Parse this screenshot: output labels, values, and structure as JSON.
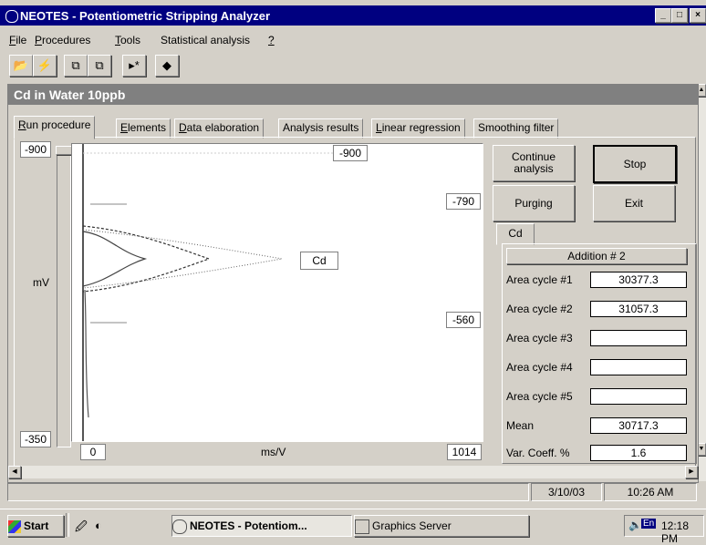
{
  "window": {
    "title": "NEOTES - Potentiometric Stripping Analyzer",
    "controls": [
      "_",
      "ÿ",
      "×"
    ]
  },
  "menu": [
    {
      "mnemonic": "F",
      "rest": "ile"
    },
    {
      "mnemonic": "P",
      "rest": "rocedures"
    },
    {
      "mnemonic": "T",
      "rest": "ools"
    },
    {
      "label": "Statistical analysis"
    },
    {
      "mnemonic": "?",
      "rest": ""
    }
  ],
  "toolbar_icons": [
    "open-folder-icon",
    "electrode-icon",
    "copy-icon",
    "paste-icon",
    "play-step-icon",
    "sample-icon"
  ],
  "document": {
    "title": "Cd in Water 10ppb",
    "tabs": [
      {
        "mnemonic": "R",
        "rest": "un procedure",
        "active": true
      },
      {
        "mnemonic": "E",
        "rest": "lements"
      },
      {
        "mnemonic": "D",
        "rest": "ata elaboration"
      },
      {
        "label": "Analysis results"
      },
      {
        "mnemonic": "L",
        "rest": "inear regression"
      },
      {
        "label": "Smoothing filter"
      }
    ]
  },
  "chart": {
    "y_top": "-900",
    "y_bottom": "-350",
    "y_unit": "mV",
    "x_left": "0",
    "x_right": "1014",
    "x_unit": "ms/V",
    "marker_top": "-900",
    "marker_mid": "-790",
    "marker_low": "-560",
    "peak_label": "Cd"
  },
  "chart_data": {
    "type": "line",
    "title": "",
    "xlabel": "ms/V",
    "ylabel": "mV",
    "xlim": [
      0,
      1014
    ],
    "ylim": [
      -900,
      -350
    ],
    "annotations": [
      "-900",
      "-790",
      "-560",
      "Cd"
    ]
  },
  "buttons": {
    "continue": "Continue analysis",
    "stop": "Stop",
    "purging": "Purging",
    "exit": "Exit"
  },
  "results": {
    "element_tab": "Cd",
    "header": "Addition # 2",
    "rows": [
      {
        "label": "Area cycle #1",
        "value": "30377.3"
      },
      {
        "label": "Area cycle #2",
        "value": "31057.3"
      },
      {
        "label": "Area cycle #3",
        "value": ""
      },
      {
        "label": "Area cycle #4",
        "value": ""
      },
      {
        "label": "Area cycle #5",
        "value": ""
      },
      {
        "label": "Mean",
        "value": "30717.3"
      },
      {
        "label": "Var. Coeff. %",
        "value": "1.6"
      }
    ]
  },
  "status": {
    "date": "3/10/03",
    "time": "10:26 AM"
  },
  "taskbar": {
    "start": "Start",
    "tasks": [
      "NEOTES - Potentiom...",
      "Graphics Server"
    ],
    "tray_lang": "En",
    "clock": "12:18 PM"
  }
}
